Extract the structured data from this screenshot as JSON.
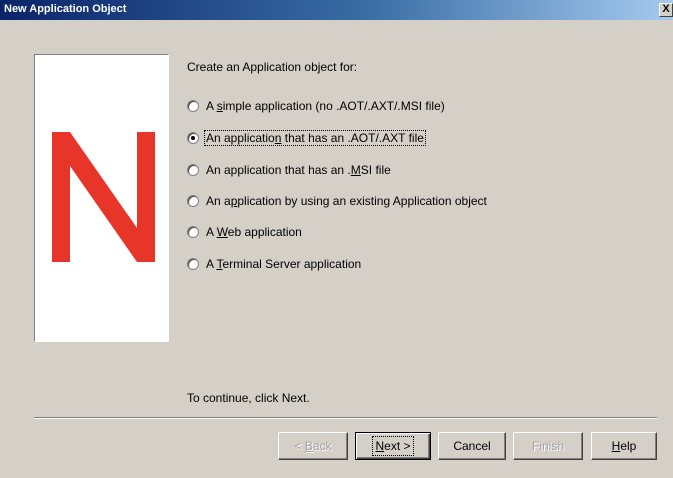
{
  "window": {
    "title": "New Application Object",
    "close_label": "X"
  },
  "main": {
    "prompt": "Create an Application object for:",
    "options": [
      {
        "pre": "A ",
        "key": "s",
        "post": "imple application (no .AOT/.AXT/.MSI file)",
        "checked": false
      },
      {
        "pre": "An application that has an .AOT/.AXT file",
        "key": "",
        "post": "",
        "checked": true
      },
      {
        "pre": "An application that has an .",
        "key": "M",
        "post": "SI file",
        "checked": false
      },
      {
        "pre": "An a",
        "key": "p",
        "post": "plication by using an existing Application object",
        "checked": false
      },
      {
        "pre": "A ",
        "key": "W",
        "post": "eb application",
        "checked": false
      },
      {
        "pre": "A ",
        "key": "T",
        "post": "erminal Server application",
        "checked": false
      }
    ],
    "hint": "To continue, click Next."
  },
  "buttons": {
    "back": {
      "pre": "< ",
      "key": "B",
      "post": "ack"
    },
    "next": {
      "pre": "",
      "key": "N",
      "post": "ext >"
    },
    "cancel": "Cancel",
    "finish": "Finish",
    "help": {
      "pre": "",
      "key": "H",
      "post": "elp"
    }
  },
  "logo": {
    "color": "#e8352a",
    "name": "novell-n-logo"
  }
}
